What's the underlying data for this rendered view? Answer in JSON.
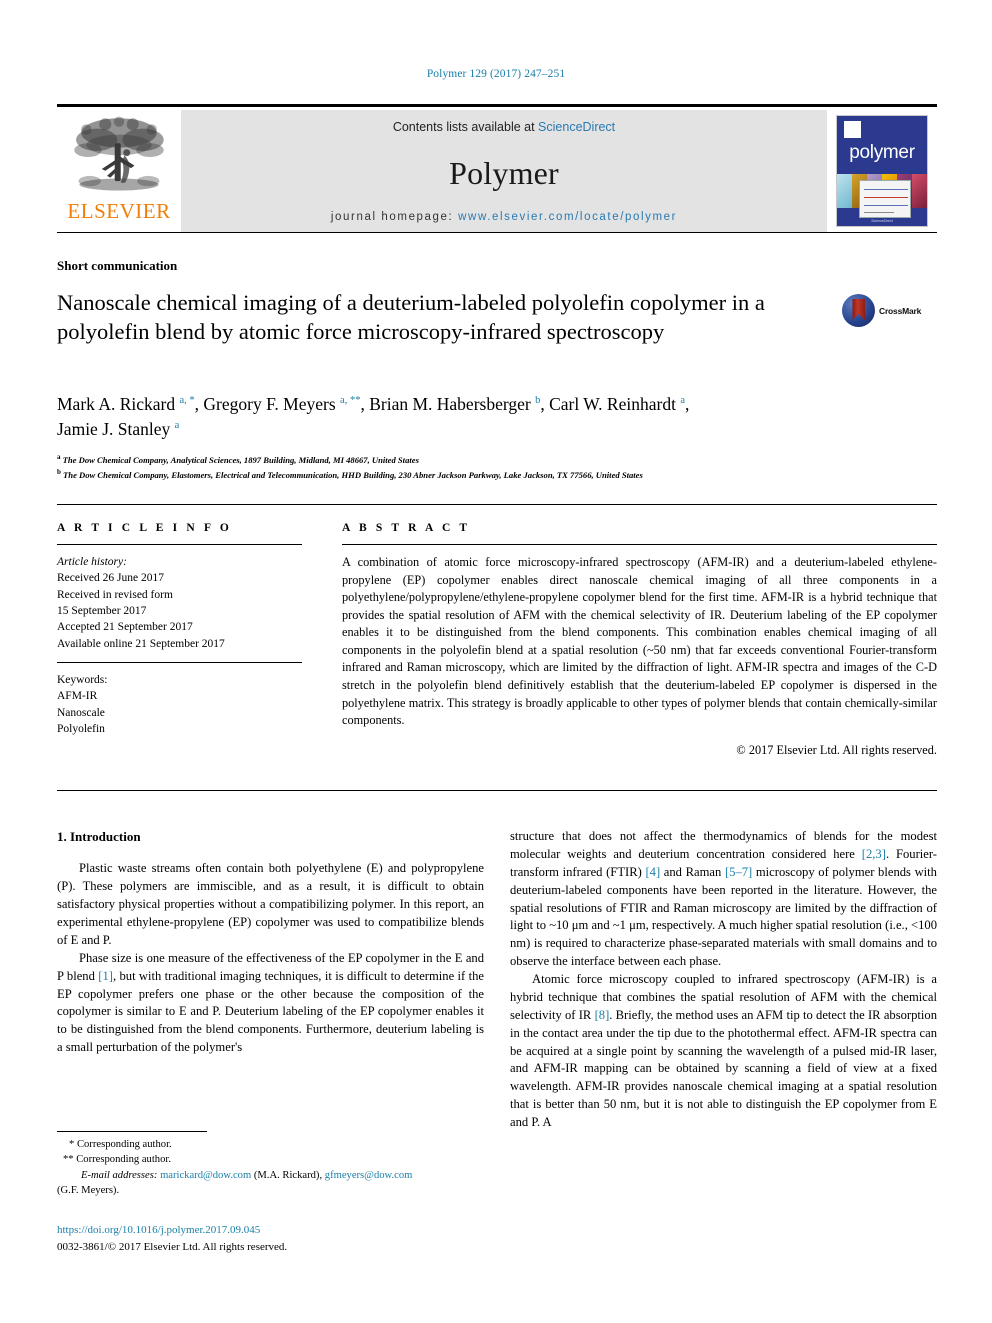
{
  "running_head": "Polymer 129 (2017) 247–251",
  "header": {
    "contents_prefix": "Contents lists available at ",
    "sciencedirect": "ScienceDirect",
    "journal_title": "Polymer",
    "homepage_prefix": "journal homepage: ",
    "homepage_url": "www.elsevier.com/locate/polymer",
    "publisher": "ELSEVIER",
    "cover_word": "polymer",
    "cover_logo_text": "ELSEVIER",
    "cover_footer": "Volume 129 Number ...",
    "accent_blue": "#2a7ab0",
    "elsevier_orange": "#f07f09",
    "cover_bg": "#2b3a8f"
  },
  "article": {
    "type": "Short communication",
    "title": "Nanoscale chemical imaging of a deuterium-labeled polyolefin copolymer in a polyolefin blend by atomic force microscopy-infrared spectroscopy",
    "crossmark_label": "CrossMark"
  },
  "authors": {
    "line1_a": "Mark A. Rickard ",
    "line1_a_sup": "a, *",
    "line1_b": ", Gregory F. Meyers ",
    "line1_b_sup": "a, **",
    "line1_c": ", Brian M. Habersberger ",
    "line1_c_sup": "b",
    "line1_d": ", Carl W. Reinhardt ",
    "line1_d_sup": "a",
    "line1_e": ",",
    "line2_a": "Jamie J. Stanley ",
    "line2_a_sup": "a",
    "affiliation_a_label": "a",
    "affiliation_a": " The Dow Chemical Company, Analytical Sciences, 1897 Building, Midland, MI 48667, United States",
    "affiliation_b_label": "b",
    "affiliation_b": " The Dow Chemical Company, Elastomers, Electrical and Telecommunication, HHD Building, 230 Abner Jackson Parkway, Lake Jackson, TX 77566, United States"
  },
  "info": {
    "heading": "A R T I C L E  I N F O",
    "history_label": "Article history:",
    "history": [
      "Received 26 June 2017",
      "Received in revised form",
      "15 September 2017",
      "Accepted 21 September 2017",
      "Available online 21 September 2017"
    ],
    "keywords_label": "Keywords:",
    "keywords": [
      "AFM-IR",
      "Nanoscale",
      "Polyolefin"
    ]
  },
  "abstract": {
    "heading": "A B S T R A C T",
    "text": "A combination of atomic force microscopy-infrared spectroscopy (AFM-IR) and a deuterium-labeled ethylene-propylene (EP) copolymer enables direct nanoscale chemical imaging of all three components in a polyethylene/polypropylene/ethylene-propylene copolymer blend for the first time. AFM-IR is a hybrid technique that provides the spatial resolution of AFM with the chemical selectivity of IR. Deuterium labeling of the EP copolymer enables it to be distinguished from the blend components. This combination enables chemical imaging of all components in the polyolefin blend at a spatial resolution (~50 nm) that far exceeds conventional Fourier-transform infrared and Raman microscopy, which are limited by the diffraction of light. AFM-IR spectra and images of the C-D stretch in the polyolefin blend definitively establish that the deuterium-labeled EP copolymer is dispersed in the polyethylene matrix. This strategy is broadly applicable to other types of polymer blends that contain chemically-similar components.",
    "copyright": "© 2017 Elsevier Ltd. All rights reserved."
  },
  "body": {
    "section_title": "1.  Introduction",
    "left_p1": "Plastic waste streams often contain both polyethylene (E) and polypropylene (P). These polymers are immiscible, and as a result, it is difficult to obtain satisfactory physical properties without a compatibilizing polymer. In this report, an experimental ethylene-propylene (EP) copolymer was used to compatibilize blends of E and P.",
    "left_p2_a": "Phase size is one measure of the effectiveness of the EP copolymer in the E and P blend ",
    "left_p2_ref": "[1]",
    "left_p2_b": ", but with traditional imaging techniques, it is difficult to determine if the EP copolymer prefers one phase or the other because the composition of the copolymer is similar to E and P. Deuterium labeling of the EP copolymer enables it to be distinguished from the blend components. Furthermore, deuterium labeling is a small perturbation of the polymer's",
    "right_p1_a": "structure that does not affect the thermodynamics of blends for the modest molecular weights and deuterium concentration considered here ",
    "right_p1_ref1": "[2,3]",
    "right_p1_b": ". Fourier-transform infrared (FTIR) ",
    "right_p1_ref2": "[4]",
    "right_p1_c": " and Raman ",
    "right_p1_ref3": "[5–7]",
    "right_p1_d": " microscopy of polymer blends with deuterium-labeled components have been reported in the literature. However, the spatial resolutions of FTIR and Raman microscopy are limited by the diffraction of light to ~10 μm and ~1 μm, respectively. A much higher spatial resolution (i.e., <100 nm) is required to characterize phase-separated materials with small domains and to observe the interface between each phase.",
    "right_p2_a": "Atomic force microscopy coupled to infrared spectroscopy (AFM-IR) is a hybrid technique that combines the spatial resolution of AFM with the chemical selectivity of IR ",
    "right_p2_ref": "[8]",
    "right_p2_b": ". Briefly, the method uses an AFM tip to detect the IR absorption in the contact area under the tip due to the photothermal effect. AFM-IR spectra can be acquired at a single point by scanning the wavelength of a pulsed mid-IR laser, and AFM-IR mapping can be obtained by scanning a field of view at a fixed wavelength. AFM-IR provides nanoscale chemical imaging at a spatial resolution that is better than 50 nm, but it is not able to distinguish the EP copolymer from E and P. A"
  },
  "footnotes": {
    "corr1": "* Corresponding author.",
    "corr2": "** Corresponding author.",
    "email_label": "E-mail addresses:",
    "email1": "marickard@dow.com",
    "email1_owner": " (M.A. Rickard), ",
    "email2": "gfmeyers@dow.com",
    "email2_owner": "(G.F. Meyers).",
    "doi": "https://doi.org/10.1016/j.polymer.2017.09.045",
    "issn_line": "0032-3861/© 2017 Elsevier Ltd. All rights reserved."
  }
}
